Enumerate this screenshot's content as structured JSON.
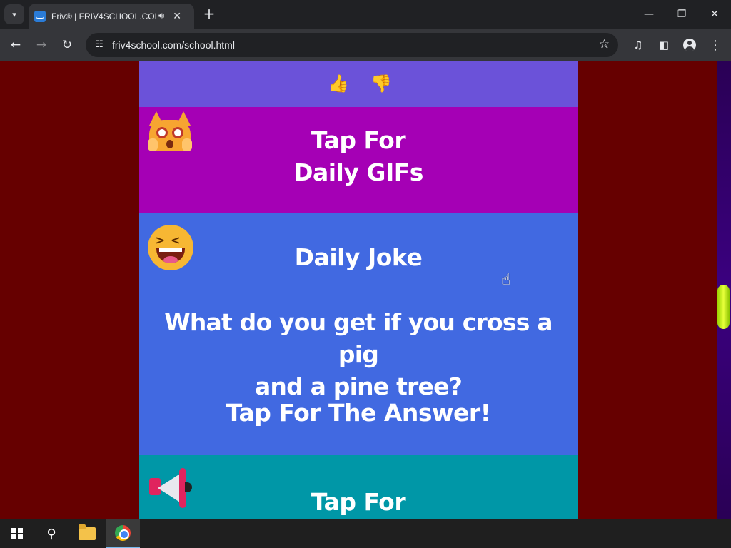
{
  "browser": {
    "tab_title": "Friv® | FRIV4SCHOOL.COM",
    "url": "friv4school.com/school.html",
    "icons": {
      "tab_search": "chevron-down-icon",
      "audio": "speaker-icon",
      "close_tab": "close-icon",
      "new_tab": "plus-icon",
      "back": "arrow-left-icon",
      "forward": "arrow-right-icon",
      "reload": "reload-icon",
      "site_info": "tune-icon",
      "bookmark": "star-icon",
      "media": "media-control-icon",
      "side_panel": "side-panel-icon",
      "profile": "profile-icon",
      "menu": "kebab-menu-icon"
    },
    "window_controls": [
      "minimize",
      "maximize",
      "close"
    ]
  },
  "page": {
    "rating": {
      "up_icon": "thumbs-up-icon",
      "down_icon": "thumbs-down-icon"
    },
    "gif_panel": {
      "line1": "Tap For",
      "line2": "Daily GIFs",
      "icon": "shocked-cat-icon"
    },
    "joke_panel": {
      "heading": "Daily Joke",
      "question_line1": "What do you get if you cross a pig",
      "question_line2": "and a pine tree?",
      "cta": "Tap For The Answer!",
      "icon": "laughing-face-icon"
    },
    "announce_panel": {
      "line1": "Tap For",
      "icon": "megaphone-icon"
    },
    "colors": {
      "background": "#660000",
      "rating_panel": "#6b52d9",
      "gif_panel": "#a500b5",
      "joke_panel": "#4169e1",
      "announce_panel": "#0097a7"
    }
  },
  "taskbar": {
    "items": [
      "start-icon",
      "search-icon",
      "file-explorer-icon",
      "chrome-icon"
    ]
  }
}
